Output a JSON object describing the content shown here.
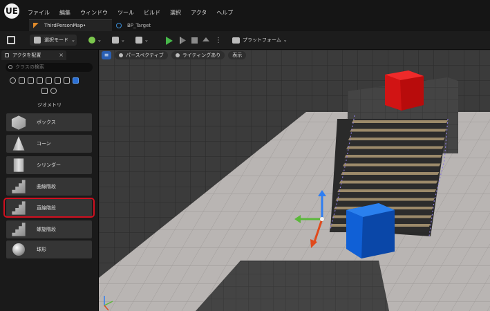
{
  "app": {
    "logo": "UE"
  },
  "menu": [
    "ファイル",
    "編集",
    "ウィンドウ",
    "ツール",
    "ビルド",
    "選択",
    "アクタ",
    "ヘルプ"
  ],
  "tabs": [
    {
      "label": "ThirdPersonMap•",
      "icon": "level-icon"
    },
    {
      "label": "BP_Target",
      "icon": "blueprint-icon"
    }
  ],
  "toolbar": {
    "mode_label": "選択モード",
    "platform_label": "プラットフォーム"
  },
  "panel": {
    "title": "アクタを配置",
    "search_placeholder": "クラスの検索",
    "category_label": "ジオメトリ",
    "items": [
      {
        "label": "ボックス",
        "icon": "box-icon"
      },
      {
        "label": "コーン",
        "icon": "cone-icon"
      },
      {
        "label": "シリンダー",
        "icon": "cylinder-icon"
      },
      {
        "label": "曲線階段",
        "icon": "curved-stairs-icon"
      },
      {
        "label": "直線階段",
        "icon": "linear-stairs-icon"
      },
      {
        "label": "螺旋階段",
        "icon": "spiral-stairs-icon"
      },
      {
        "label": "球形",
        "icon": "sphere-icon"
      }
    ]
  },
  "viewport": {
    "perspective_label": "パースペクティブ",
    "lighting_label": "ライティングあり",
    "show_label": "表示"
  },
  "colors": {
    "accent_red": "#d10f1f",
    "play_green": "#47b84a",
    "cube_red": "#e01616",
    "cube_blue": "#1060d6"
  }
}
